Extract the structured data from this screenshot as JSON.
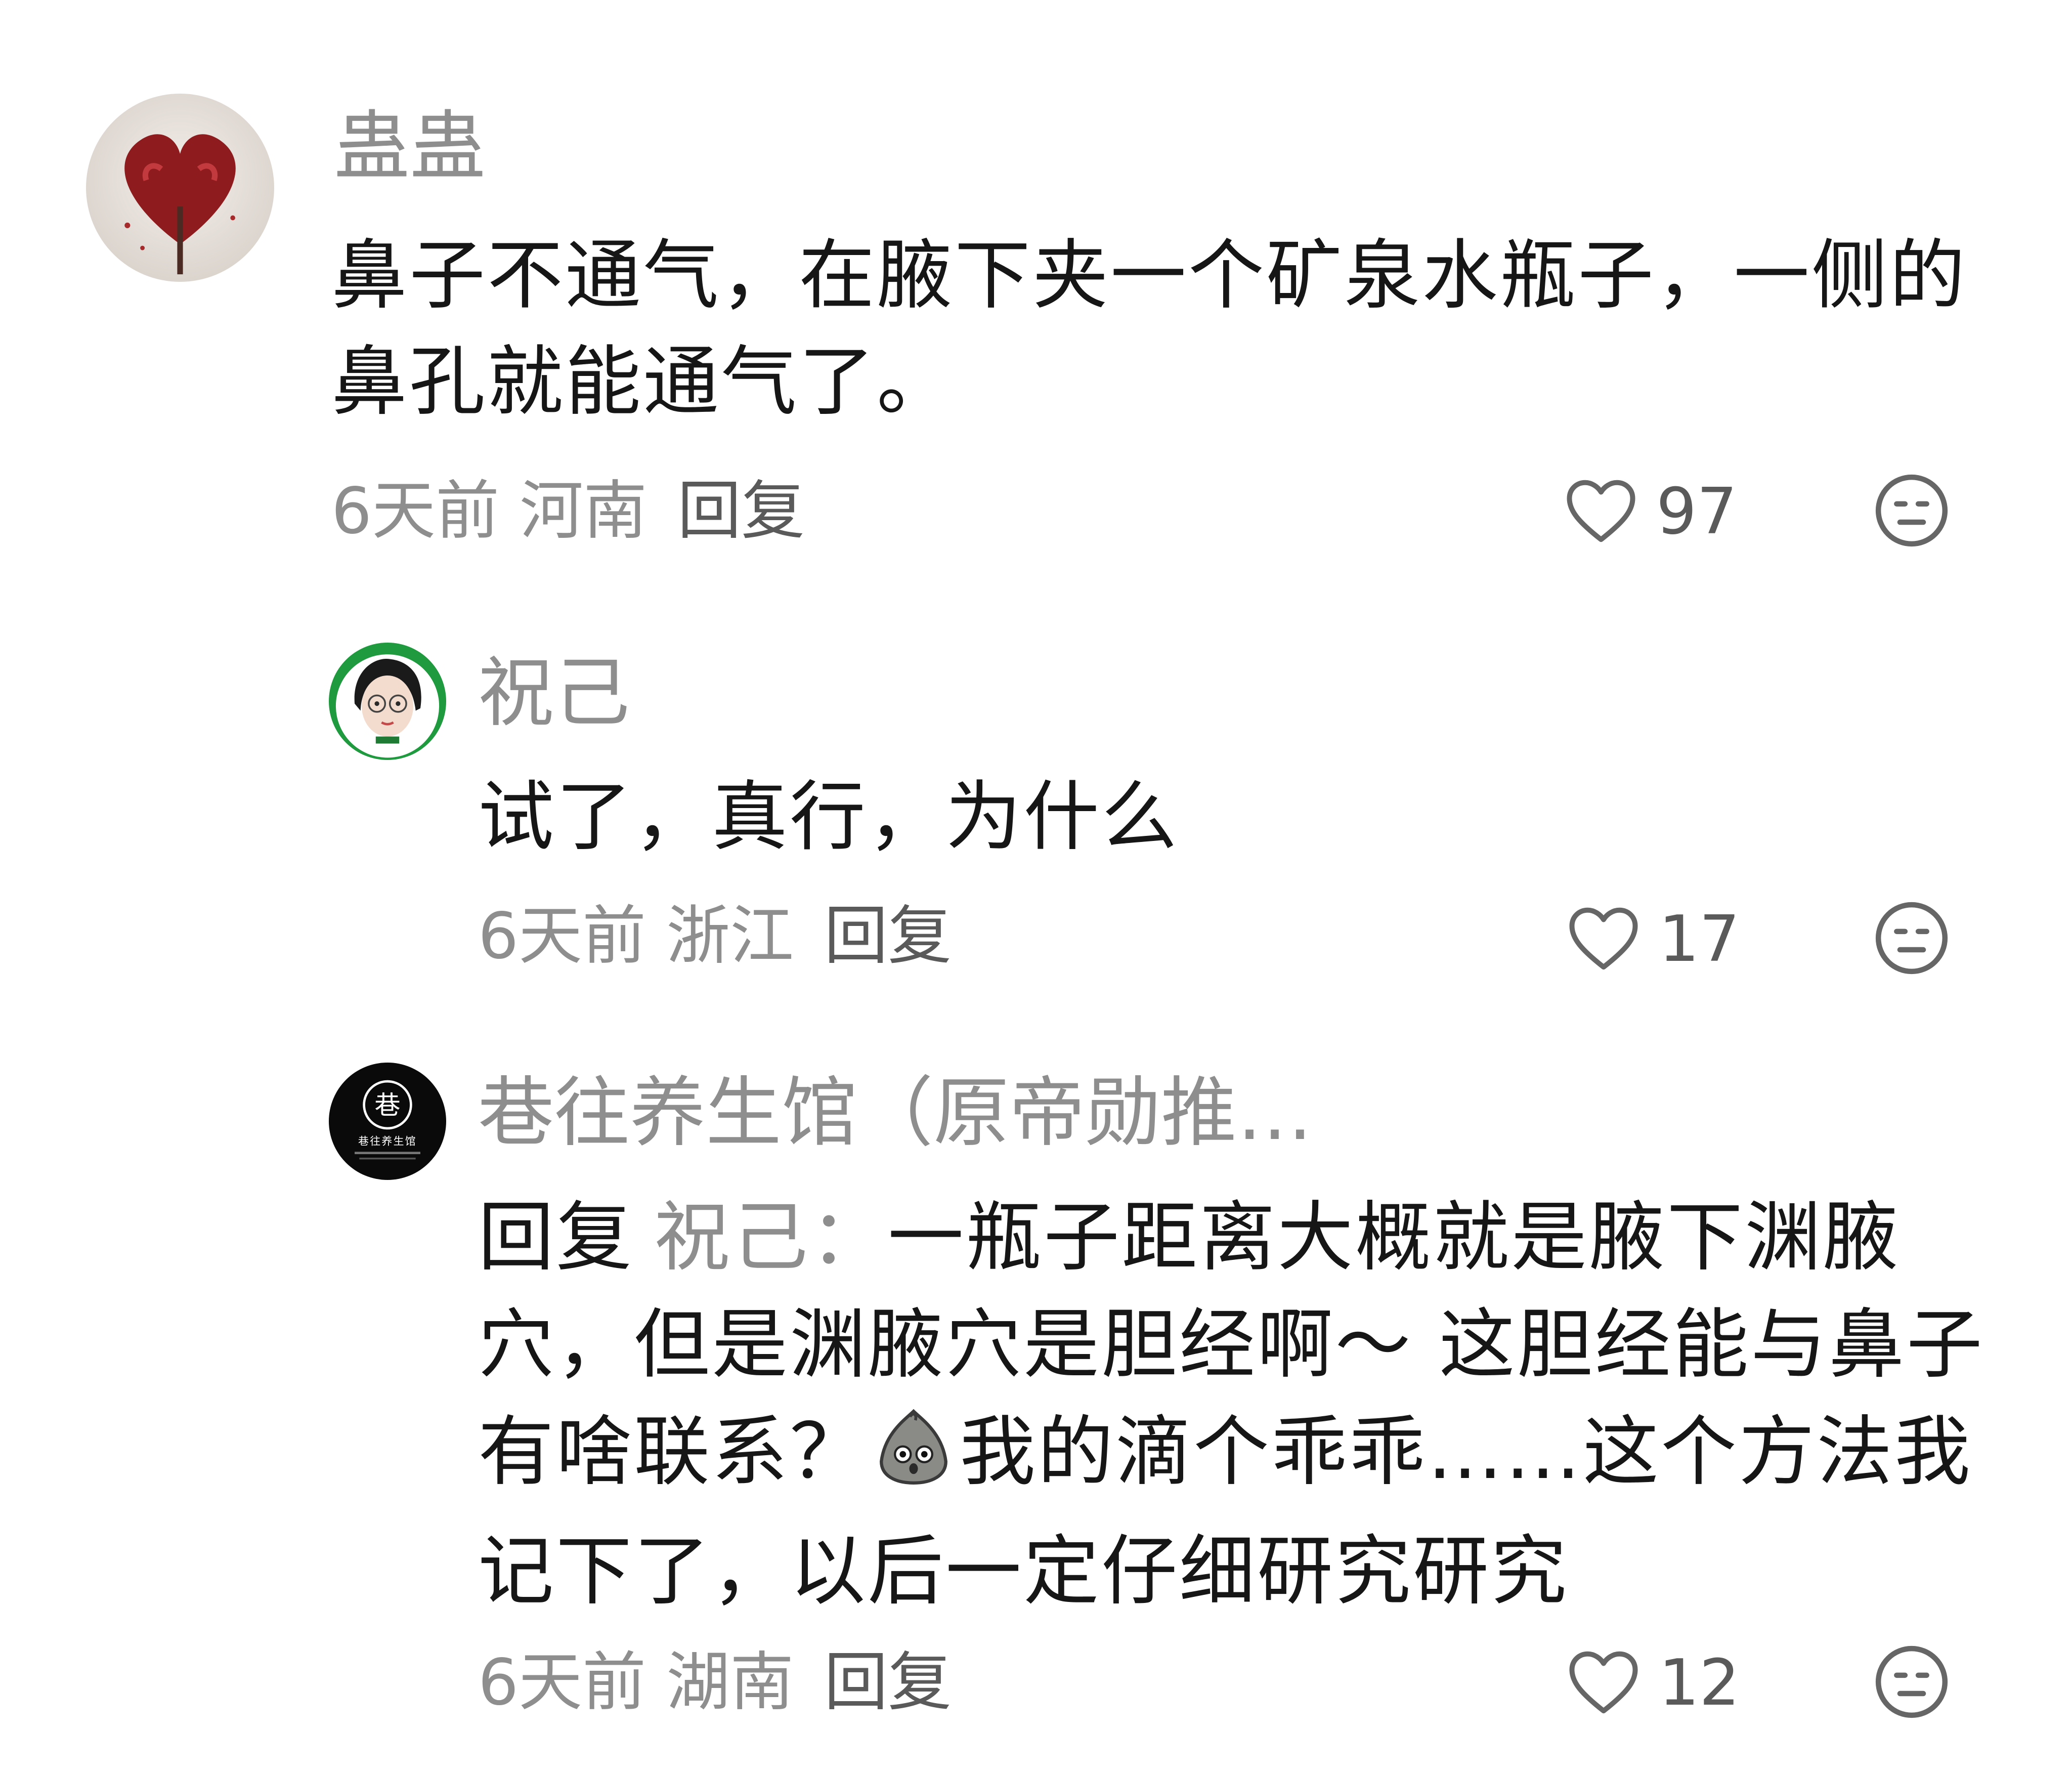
{
  "comments": [
    {
      "username": "蛊蛊",
      "text": "鼻子不通气，在腋下夹一个矿泉水瓶子，一侧的鼻孔就能通气了。",
      "time": "6天前",
      "region": "河南",
      "reply_label": "回复",
      "likes": "97"
    },
    {
      "username": "祝己",
      "text": "试了，真行，为什么",
      "time": "6天前",
      "region": "浙江",
      "reply_label": "回复",
      "likes": "17"
    },
    {
      "username": "巷往养生馆（原帝勋推…",
      "reply_prefix": "回复",
      "reply_to": "祝己：",
      "text_part1": "一瓶子距离大概就是腋下渊腋穴，但是渊腋穴是胆经啊～ 这胆经能与鼻子有啥联系？",
      "text_part2": "我的滴个乖乖……这个方法我记下了，以后一定仔细研究研究",
      "time": "6天前",
      "region": "湖南",
      "reply_label": "回复",
      "likes": "12"
    }
  ],
  "icons": {
    "like": "heart-outline-icon",
    "emoji": "neutral-face-icon",
    "inline_emoji": "dumpling-face-emoji"
  },
  "colors": {
    "text": "#161616",
    "muted": "#8e8e8e",
    "icon": "#666666"
  }
}
